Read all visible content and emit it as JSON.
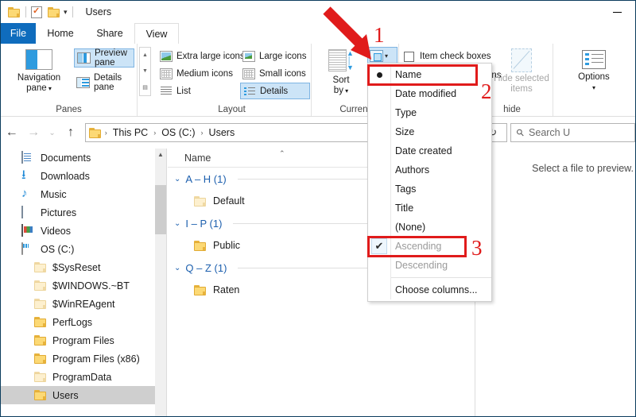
{
  "window": {
    "title": "Users",
    "minimize_label": "–",
    "quick_access": [
      "folder-icon",
      "properties-icon",
      "new-folder-icon",
      "customize-caret"
    ]
  },
  "tabs": [
    {
      "label": "File",
      "active": false,
      "accent": "#0f6cbd"
    },
    {
      "label": "Home",
      "active": false
    },
    {
      "label": "Share",
      "active": false
    },
    {
      "label": "View",
      "active": true
    }
  ],
  "ribbon": {
    "groups": [
      {
        "label": "Panes"
      },
      {
        "label": "Layout"
      },
      {
        "label": "Current"
      },
      {
        "label": "hide"
      },
      {
        "label": ""
      }
    ],
    "panes": {
      "navigation_pane": "Navigation",
      "navigation_pane_2": "pane",
      "preview_pane": "Preview pane",
      "details_pane": "Details pane",
      "group_label": "Panes"
    },
    "layout": {
      "extra_large_icons": "Extra large icons",
      "large_icons": "Large icons",
      "medium_icons": "Medium icons",
      "small_icons": "Small icons",
      "list": "List",
      "details": "Details",
      "group_label": "Layout",
      "selected": "Details"
    },
    "current_view": {
      "sort_by_line1": "Sort",
      "sort_by_line2": "by",
      "group_label": "Current"
    },
    "show_hide": {
      "item_check_boxes": "Item check boxes",
      "file_name_extensions_partial": "ons",
      "hide_selected_items_line1": "Hide selected",
      "hide_selected_items_line2": "items",
      "group_label": "hide"
    },
    "options": {
      "label": "Options",
      "caret": "▾"
    }
  },
  "address_bar": {
    "back": "←",
    "forward": "→",
    "recent": "⌄",
    "up": "↑",
    "breadcrumbs": [
      "This PC",
      "OS (C:)",
      "Users"
    ],
    "separator": "›",
    "dropdown_caret": "⌄",
    "refresh": "↻",
    "search_placeholder": "Search U"
  },
  "navigation_pane": {
    "items": [
      {
        "label": "Documents",
        "icon": "documents-icon",
        "indent": 0
      },
      {
        "label": "Downloads",
        "icon": "downloads-icon",
        "indent": 0
      },
      {
        "label": "Music",
        "icon": "music-icon",
        "indent": 0
      },
      {
        "label": "Pictures",
        "icon": "pictures-icon",
        "indent": 0
      },
      {
        "label": "Videos",
        "icon": "videos-icon",
        "indent": 0
      },
      {
        "label": "OS (C:)",
        "icon": "drive-icon",
        "indent": 0
      },
      {
        "label": "$SysReset",
        "icon": "folder-dim-icon",
        "indent": 1
      },
      {
        "label": "$WINDOWS.~BT",
        "icon": "folder-dim-icon",
        "indent": 1
      },
      {
        "label": "$WinREAgent",
        "icon": "folder-dim-icon",
        "indent": 1
      },
      {
        "label": "PerfLogs",
        "icon": "folder-icon",
        "indent": 1
      },
      {
        "label": "Program Files",
        "icon": "folder-icon",
        "indent": 1
      },
      {
        "label": "Program Files (x86)",
        "icon": "folder-icon",
        "indent": 1
      },
      {
        "label": "ProgramData",
        "icon": "folder-dim-icon",
        "indent": 1
      },
      {
        "label": "Users",
        "icon": "folder-icon",
        "indent": 1,
        "selected": true
      }
    ]
  },
  "file_list": {
    "column_header": "Name",
    "sort_indicator": "⌃",
    "groups": [
      {
        "header": "A – H (1)",
        "chevron": "⌄",
        "items": [
          {
            "name": "Default",
            "icon": "folder-dim-icon"
          }
        ]
      },
      {
        "header": "I – P (1)",
        "chevron": "⌄",
        "items": [
          {
            "name": "Public",
            "icon": "folder-icon"
          }
        ]
      },
      {
        "header": "Q – Z (1)",
        "chevron": "⌄",
        "items": [
          {
            "name": "Raten",
            "icon": "folder-icon"
          }
        ]
      }
    ]
  },
  "preview_pane": {
    "message": "Select a file to preview."
  },
  "sort_menu": {
    "items": [
      {
        "label": "Name",
        "marker": "radio",
        "checked": true,
        "disabled": false
      },
      {
        "label": "Date modified",
        "marker": "none",
        "disabled": false
      },
      {
        "label": "Type",
        "marker": "none",
        "disabled": false
      },
      {
        "label": "Size",
        "marker": "none",
        "disabled": false
      },
      {
        "label": "Date created",
        "marker": "none",
        "disabled": false
      },
      {
        "label": "Authors",
        "marker": "none",
        "disabled": false
      },
      {
        "label": "Tags",
        "marker": "none",
        "disabled": false
      },
      {
        "label": "Title",
        "marker": "none",
        "disabled": false
      },
      {
        "label": "(None)",
        "marker": "none",
        "disabled": false
      },
      {
        "label": "Ascending",
        "marker": "check",
        "checked": true,
        "disabled": true
      },
      {
        "label": "Descending",
        "marker": "none",
        "disabled": true
      },
      {
        "label": "Choose columns...",
        "marker": "none",
        "disabled": false
      }
    ]
  },
  "annotations": {
    "color": "#e01b1b",
    "step1": "1",
    "step2": "2",
    "step3": "3"
  }
}
